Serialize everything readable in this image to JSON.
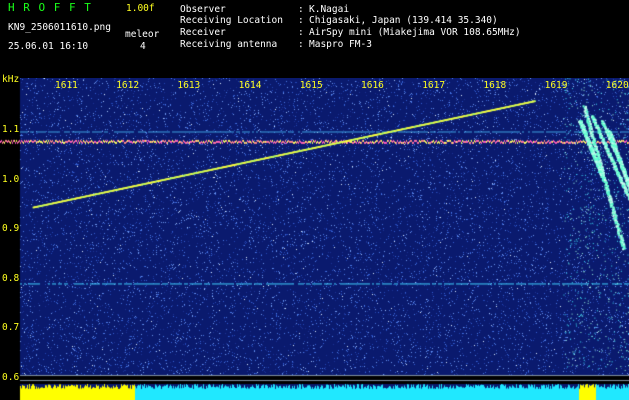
{
  "header": {
    "title": "H R O F F T",
    "version": "1.00f",
    "filename": "KN9_2506011610.png",
    "mode_label": "meleor",
    "mode_value": "4",
    "timestamp": "25.06.01 16:10"
  },
  "info": {
    "rows": [
      {
        "key": "Observer",
        "sep": ":",
        "value": "K.Nagai"
      },
      {
        "key": "Receiving Location",
        "sep": ":",
        "value": "Chigasaki, Japan (139.414 35.340)"
      },
      {
        "key": "Receiver",
        "sep": ":",
        "value": "AirSpy mini (Miakejima VOR 108.65MHz)"
      },
      {
        "key": "Receiving antenna",
        "sep": ":",
        "value": "Maspro FM-3"
      }
    ]
  },
  "chart_data": {
    "type": "heatmap",
    "xlabel": "",
    "ylabel": "kHz",
    "x_ticks": [
      "1611",
      "1612",
      "1613",
      "1614",
      "1615",
      "1616",
      "1617",
      "1618",
      "1619",
      "1620"
    ],
    "y_ticks": [
      "1.1",
      "1.0",
      "0.9",
      "0.8",
      "0.7",
      "0.6"
    ],
    "ylim": [
      0.58,
      1.16
    ],
    "xlim": [
      1610.6,
      1620.5
    ],
    "features": {
      "carrier_khz": 1.078,
      "reference_line_khz": 0.79,
      "reference_line2_khz": 1.097,
      "drift_line": {
        "start": [
          1610.6,
          0.945
        ],
        "end": [
          1618.8,
          1.16
        ]
      },
      "meteor_time": 1619.6
    },
    "colors": {
      "background": "#0a1a6e",
      "noise": "#2f59c8",
      "carrier": "#ff8a8a",
      "drift": "#ffff40",
      "reference": "#40d0ff",
      "echo": "#60ffd0",
      "amplitude_low": "#ffff00",
      "amplitude_high": "#20e8ff"
    }
  }
}
